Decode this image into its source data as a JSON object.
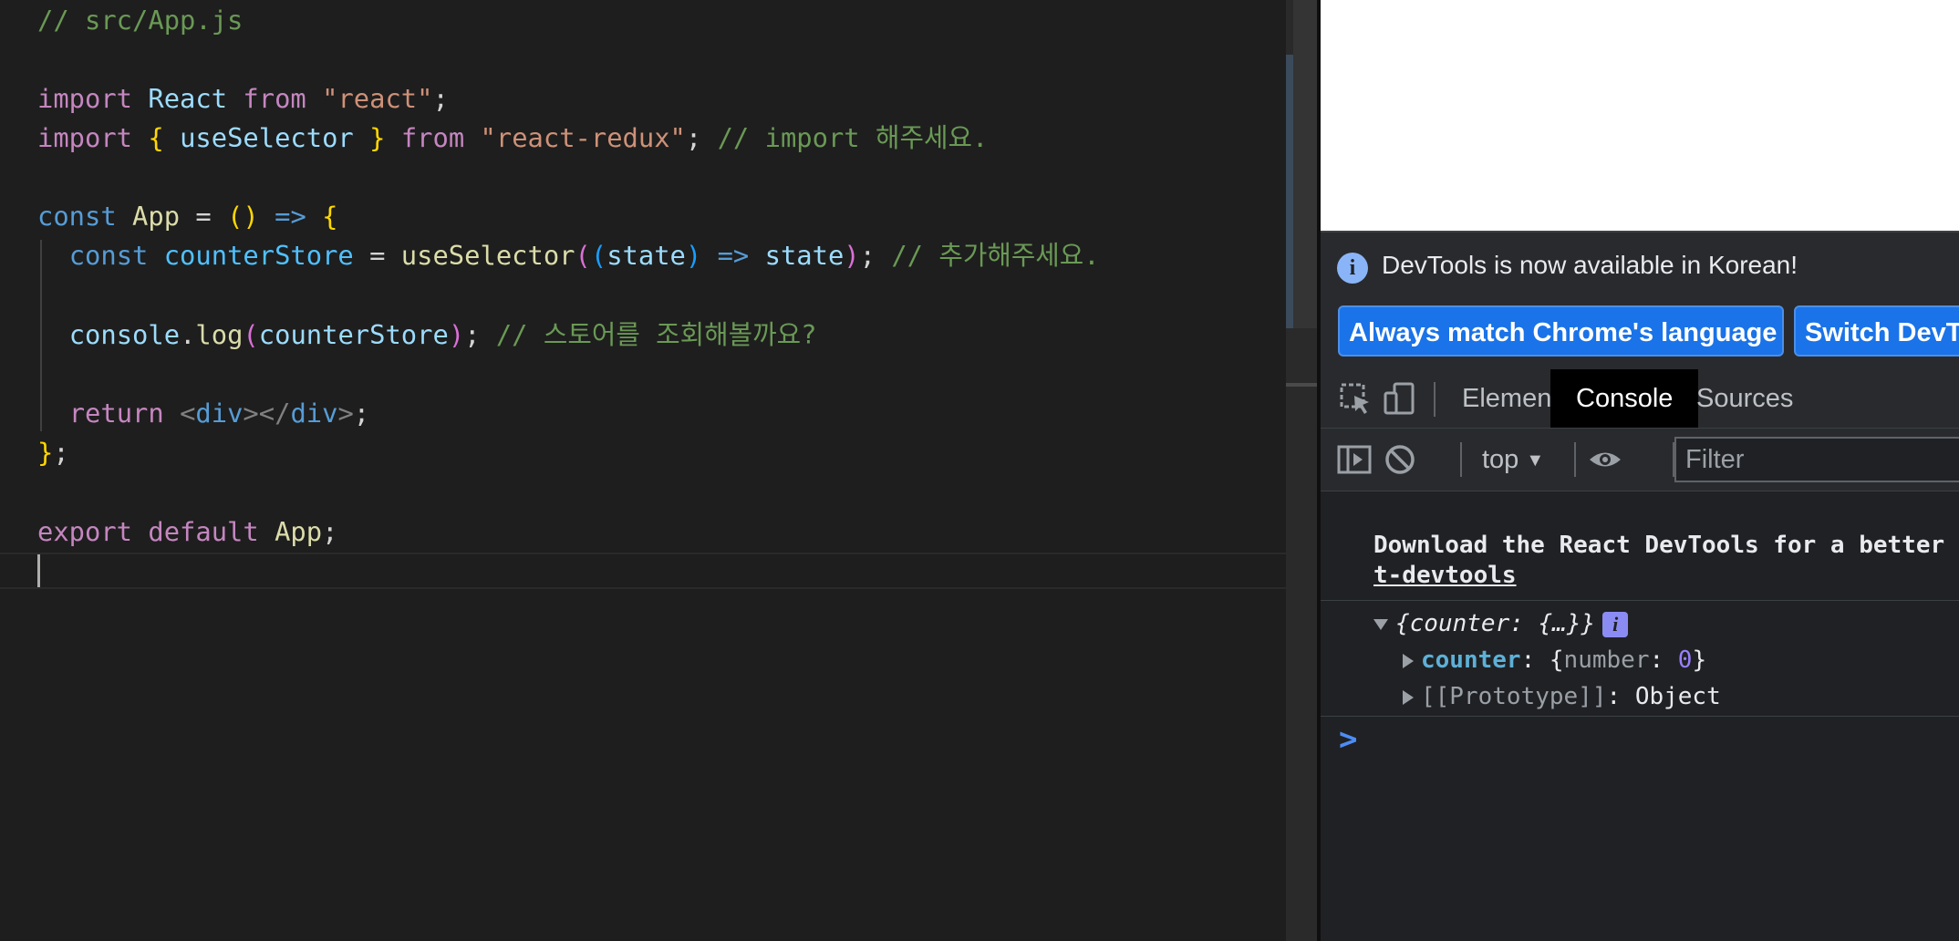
{
  "editor": {
    "lines": {
      "l1": {
        "comment": "// src/App.js"
      },
      "l3": {
        "import_kw": "import",
        "react_name": "React",
        "from_kw": "from",
        "module": "\"react\"",
        "semi": ";"
      },
      "l4": {
        "import_kw": "import",
        "brace_open": "{",
        "use_selector": "useSelector",
        "brace_close": "}",
        "from_kw": "from",
        "module": "\"react-redux\"",
        "semi": ";",
        "comment": "// import 해주세요."
      },
      "l6": {
        "const_kw": "const",
        "app_name": "App",
        "eq": "=",
        "parens": "()",
        "arrow": "=>",
        "brace": "{"
      },
      "l7": {
        "const_kw": "const",
        "var_name": "counterStore",
        "eq": "=",
        "fn": "useSelector",
        "p_open": "(",
        "p2_open": "(",
        "param": "state",
        "p2_close": ")",
        "arrow": "=>",
        "ret": "state",
        "p_close": ")",
        "semi": ";",
        "comment": "// 추가해주세요."
      },
      "l9": {
        "obj": "console",
        "dot": ".",
        "fn": "log",
        "p_open": "(",
        "arg": "counterStore",
        "p_close": ")",
        "semi": ";",
        "comment": "// 스토어를 조회해볼까요?"
      },
      "l11": {
        "return_kw": "return",
        "lt1": "<",
        "tag1": "div",
        "gt1": "></",
        "tag2": "div",
        "gt2": ">",
        "semi": ";"
      },
      "l12": {
        "brace": "}",
        "semi": ";"
      },
      "l14": {
        "export_kw": "export",
        "default_kw": "default",
        "app_name": "App",
        "semi": ";"
      }
    }
  },
  "devtools": {
    "notice": {
      "text": "DevTools is now available in Korean!",
      "btn_match": "Always match Chrome's language",
      "btn_switch": "Switch DevTools to Korean"
    },
    "tabs": [
      "Elements",
      "Console",
      "Sources"
    ],
    "active_tab": "Console",
    "console_toolbar": {
      "context": "top",
      "filter_placeholder": "Filter"
    },
    "console": {
      "react_msg_line1": "Download the React DevTools for a better development experience: https://reactjs.org/link/react-devtools",
      "react_msg_line2": "t-devtools",
      "object_summary": "{counter: {…}}",
      "info_badge": "i",
      "prop_key": "counter",
      "prop_value_key": "number",
      "prop_value_num": "0",
      "proto_key": "[[Prototype]]",
      "proto_value": "Object",
      "prompt": ">"
    }
  },
  "colors": {
    "editor_bg": "#1e1e1e",
    "accent_blue": "#1a73e8",
    "console_key": "#5db0d7"
  }
}
